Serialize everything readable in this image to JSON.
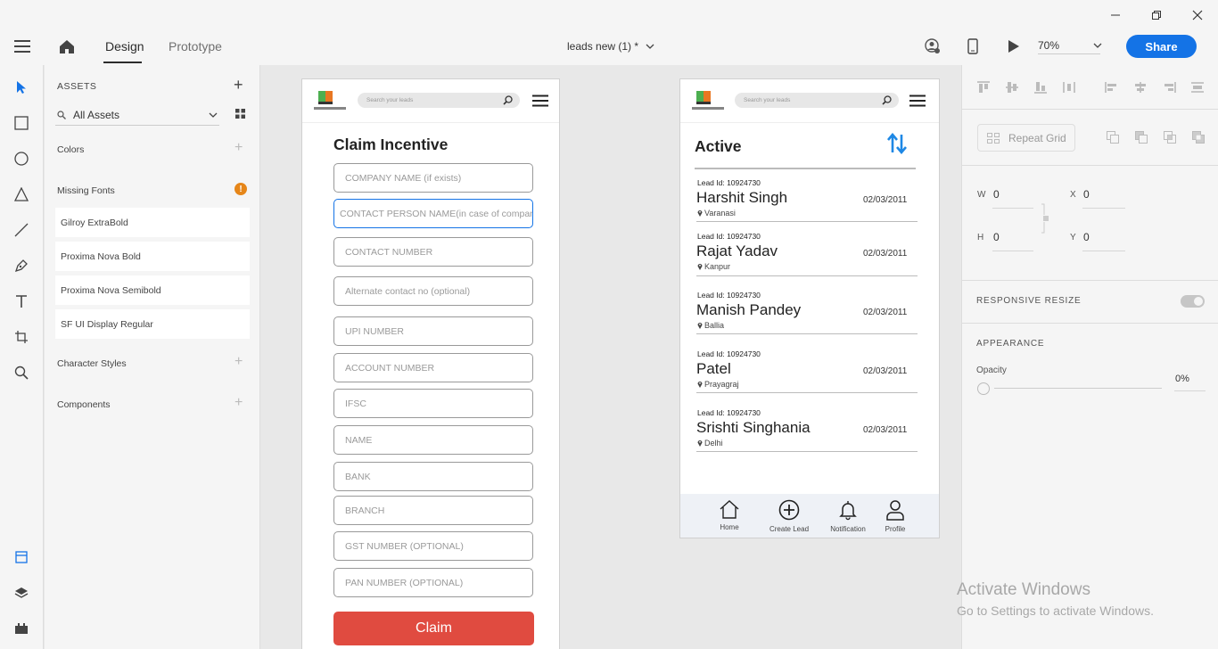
{
  "window": {
    "minimize_icon": "minimize-icon",
    "restore_icon": "restore-icon",
    "close_icon": "close-icon"
  },
  "header": {
    "tabs": [
      {
        "label": "Design",
        "active": true
      },
      {
        "label": "Prototype",
        "active": false
      }
    ],
    "document_title": "leads new (1) *",
    "zoom": "70%",
    "share_label": "Share",
    "share_color": "#1473e6"
  },
  "assets": {
    "title": "ASSETS",
    "filter_label": "All Assets",
    "colors_label": "Colors",
    "missing_fonts_label": "Missing Fonts",
    "missing_fonts": [
      "Gilroy ExtraBold",
      "Proxima Nova Bold",
      "Proxima Nova Semibold",
      "SF UI Display Regular"
    ],
    "character_styles_label": "Character Styles",
    "components_label": "Components"
  },
  "claim_artboard": {
    "search_placeholder": "Search your leads",
    "heading": "Claim Incentive",
    "fields": [
      "COMPANY NAME (if exists)",
      "CONTACT PERSON NAME(in case of company)",
      "CONTACT NUMBER",
      "Alternate contact no (optional)",
      "UPI NUMBER",
      "ACCOUNT NUMBER",
      "IFSC",
      "NAME",
      "BANK",
      "BRANCH",
      "GST NUMBER (OPTIONAL)",
      "PAN  NUMBER (OPTIONAL)"
    ],
    "claim_label": "Claim",
    "claim_color": "#e04b40"
  },
  "dashboard_artboard": {
    "search_placeholder": "Search your leads",
    "heading": "Active",
    "accent_color": "#1e88e5",
    "leads": [
      {
        "id": "Lead Id: 10924730",
        "name": "Harshit Singh",
        "date": "02/03/2011",
        "location": "Varanasi"
      },
      {
        "id": "Lead Id: 10924730",
        "name": "Rajat Yadav",
        "date": "02/03/2011",
        "location": "Kanpur"
      },
      {
        "id": "Lead Id: 10924730",
        "name": "Manish Pandey",
        "date": "02/03/2011",
        "location": "Ballia"
      },
      {
        "id": "Lead Id: 10924730",
        "name": "Patel",
        "date": "02/03/2011",
        "location": "Prayagraj"
      },
      {
        "id": "Lead Id: 10924730",
        "name": "Srishti Singhania",
        "date": "02/03/2011",
        "location": "Delhi"
      }
    ],
    "nav": [
      {
        "label": "Home",
        "icon": "home-icon"
      },
      {
        "label": "Create Lead",
        "icon": "plus-circle-icon"
      },
      {
        "label": "Notification",
        "icon": "bell-icon"
      },
      {
        "label": "Profile",
        "icon": "user-icon"
      }
    ]
  },
  "properties": {
    "repeat_grid_label": "Repeat Grid",
    "w_label": "W",
    "w_value": "0",
    "h_label": "H",
    "h_value": "0",
    "x_label": "X",
    "x_value": "0",
    "y_label": "Y",
    "y_value": "0",
    "responsive_resize_label": "RESPONSIVE RESIZE",
    "appearance_label": "APPEARANCE",
    "opacity_label": "Opacity",
    "opacity_value": "0%"
  },
  "watermark": {
    "title": "Activate Windows",
    "subtitle": "Go to Settings to activate Windows."
  }
}
